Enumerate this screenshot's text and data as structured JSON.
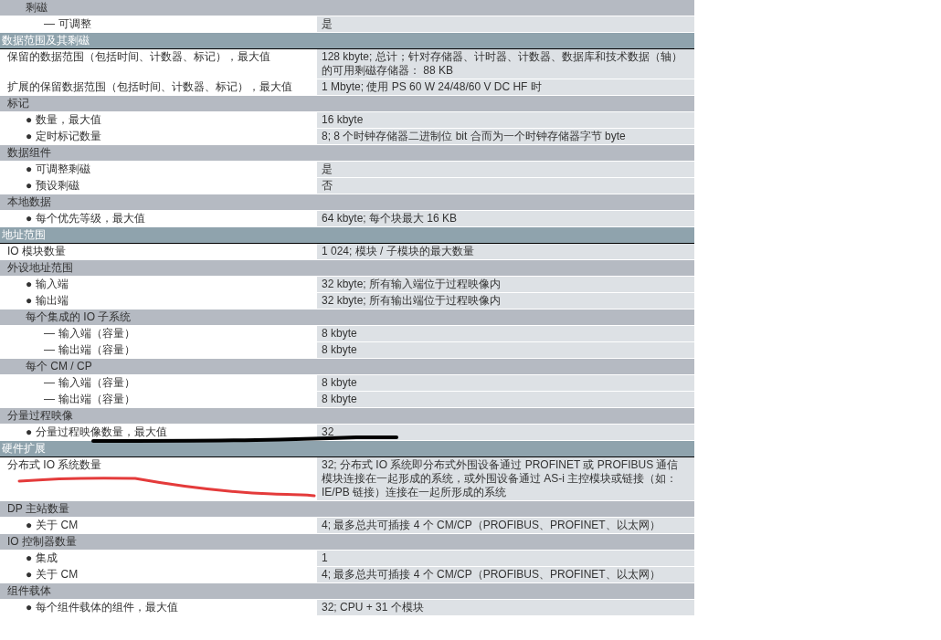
{
  "rows": [
    {
      "kind": "continued",
      "children": [
        {
          "kind": "group",
          "label": "剩磁",
          "children": [
            {
              "kind": "item",
              "marker": "—",
              "label": "可调整",
              "value": "是"
            }
          ]
        }
      ]
    },
    {
      "kind": "section",
      "label": "数据范围及其剩磁",
      "children": [
        {
          "kind": "item",
          "label": "保留的数据范围（包括时间、计数器、标记），最大值",
          "value": "128 kbyte; 总计；针对存储器、计时器、计数器、数据库和技术数据（轴）的可用剩磁存储器： 88 KB"
        },
        {
          "kind": "item",
          "label": "扩展的保留数据范围（包括时间、计数器、标记），最大值",
          "value": "1 Mbyte; 使用 PS 60 W 24/48/60 V DC HF 时"
        },
        {
          "kind": "group",
          "label": "标记",
          "children": [
            {
              "kind": "item",
              "marker": "●",
              "label": "数量，最大值",
              "value": "16 kbyte"
            },
            {
              "kind": "item",
              "marker": "●",
              "label": "定时标记数量",
              "value": "8; 8 个时钟存储器二进制位 bit 合而为一个时钟存储器字节 byte"
            }
          ]
        },
        {
          "kind": "group",
          "label": "数据组件",
          "children": [
            {
              "kind": "item",
              "marker": "●",
              "label": "可调整剩磁",
              "value": "是"
            },
            {
              "kind": "item",
              "marker": "●",
              "label": "预设剩磁",
              "value": "否"
            }
          ]
        },
        {
          "kind": "group",
          "label": "本地数据",
          "children": [
            {
              "kind": "item",
              "marker": "●",
              "label": "每个优先等级，最大值",
              "value": "64 kbyte; 每个块最大 16 KB"
            }
          ]
        }
      ]
    },
    {
      "kind": "section",
      "label": "地址范围",
      "children": [
        {
          "kind": "item",
          "label": "IO 模块数量",
          "value": "1 024; 模块 / 子模块的最大数量"
        },
        {
          "kind": "group",
          "label": "外设地址范围",
          "children": [
            {
              "kind": "item",
              "marker": "●",
              "label": "输入端",
              "value": "32 kbyte; 所有输入端位于过程映像内"
            },
            {
              "kind": "item",
              "marker": "●",
              "label": "输出端",
              "value": "32 kbyte; 所有输出端位于过程映像内"
            },
            {
              "kind": "group",
              "label": "每个集成的 IO 子系统",
              "children": [
                {
                  "kind": "item",
                  "marker": "—",
                  "label": "输入端（容量）",
                  "value": "8 kbyte"
                },
                {
                  "kind": "item",
                  "marker": "—",
                  "label": "输出端（容量）",
                  "value": "8 kbyte"
                }
              ]
            },
            {
              "kind": "group",
              "label": "每个 CM / CP",
              "children": [
                {
                  "kind": "item",
                  "marker": "—",
                  "label": "输入端（容量）",
                  "value": "8 kbyte"
                },
                {
                  "kind": "item",
                  "marker": "—",
                  "label": "输出端（容量）",
                  "value": "8 kbyte"
                }
              ]
            }
          ]
        },
        {
          "kind": "group",
          "label": "分量过程映像",
          "children": [
            {
              "kind": "item",
              "marker": "●",
              "label": "分量过程映像数量，最大值",
              "value": "32"
            }
          ]
        }
      ]
    },
    {
      "kind": "section",
      "label": "硬件扩展",
      "children": [
        {
          "kind": "item",
          "label": "分布式 IO 系统数量",
          "value": "32; 分布式 IO 系统即分布式外围设备通过 PROFINET 或 PROFIBUS 通信模块连接在一起形成的系统，或外围设备通过 AS-i 主控模块或链接（如：IE/PB 链接）连接在一起所形成的系统"
        },
        {
          "kind": "group",
          "label": "DP 主站数量",
          "children": [
            {
              "kind": "item",
              "marker": "●",
              "label": "关于 CM",
              "value": "4; 最多总共可插接 4 个 CM/CP（PROFIBUS、PROFINET、以太网）"
            }
          ]
        },
        {
          "kind": "group",
          "label": "IO 控制器数量",
          "children": [
            {
              "kind": "item",
              "marker": "●",
              "label": "集成",
              "value": "1"
            },
            {
              "kind": "item",
              "marker": "●",
              "label": "关于 CM",
              "value": "4; 最多总共可插接 4 个 CM/CP（PROFIBUS、PROFINET、以太网）"
            }
          ]
        },
        {
          "kind": "group",
          "label": "组件载体",
          "children": [
            {
              "kind": "item",
              "marker": "●",
              "label": "每个组件载体的组件，最大值",
              "value": "32; CPU + 31 个模块"
            }
          ]
        }
      ]
    }
  ]
}
